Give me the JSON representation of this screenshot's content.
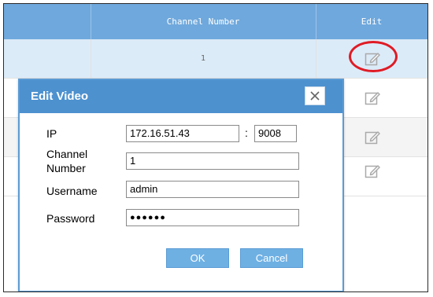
{
  "table": {
    "headers": {
      "channel_number": "Channel Number",
      "edit": "Edit"
    },
    "rows": [
      {
        "channel_number": "1"
      }
    ]
  },
  "dialog": {
    "title": "Edit Video",
    "labels": {
      "ip": "IP",
      "channel_number_line1": "Channel",
      "channel_number_line2": "Number",
      "username": "Username",
      "password": "Password",
      "colon": ":"
    },
    "values": {
      "ip": "172.16.51.43",
      "port": "9008",
      "channel_number": "1",
      "username": "admin",
      "password_masked": "●●●●●●"
    },
    "buttons": {
      "ok": "OK",
      "cancel": "Cancel"
    }
  },
  "icons": [
    "edit-icon",
    "close-icon"
  ],
  "colors": {
    "header_blue": "#6fa8dc",
    "dialog_header": "#4d91cf",
    "button": "#6fb0e3",
    "highlight": "#e01b24"
  }
}
